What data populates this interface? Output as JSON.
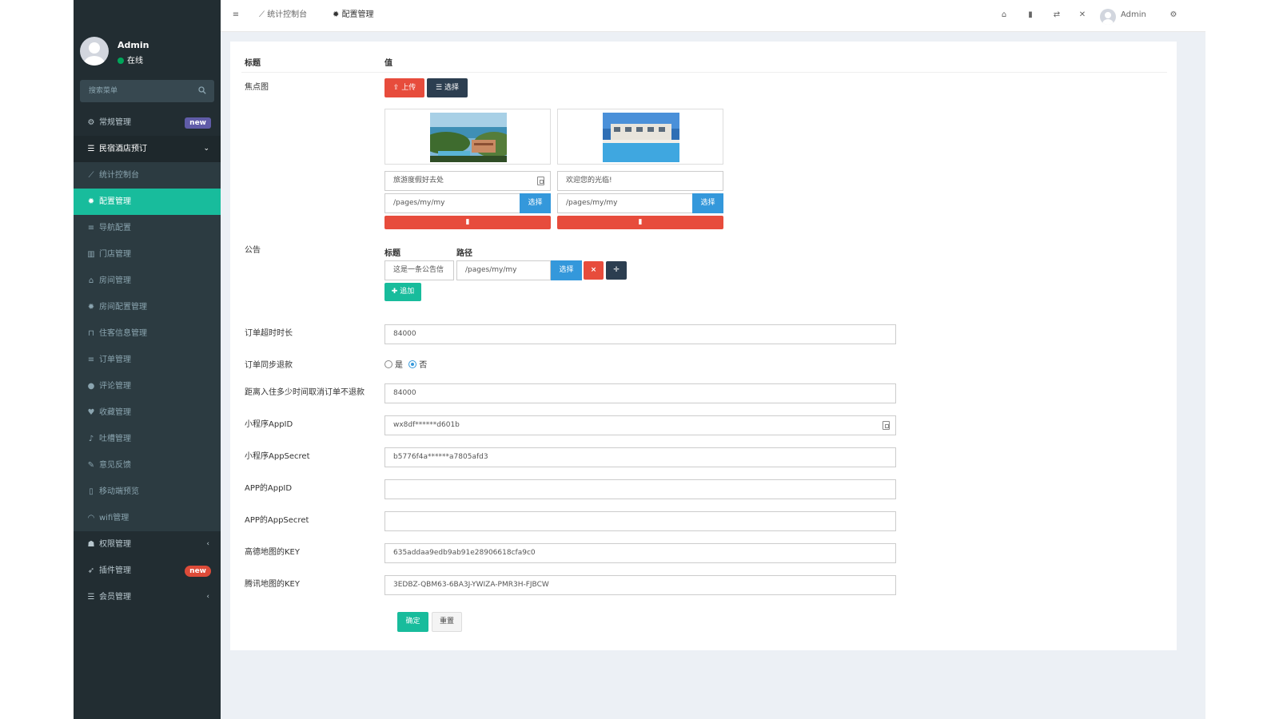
{
  "sidebar": {
    "user_name": "Admin",
    "user_status": "在线",
    "search_placeholder": "搜索菜单",
    "items": [
      {
        "label": "常规管理",
        "icon": "cogs-icon",
        "badge": "new"
      },
      {
        "label": "民宿酒店预订",
        "icon": "list-icon"
      },
      {
        "label": "统计控制台",
        "icon": "line-chart-icon"
      },
      {
        "label": "配置管理",
        "icon": "gear-icon"
      },
      {
        "label": "导航配置",
        "icon": "bars-icon"
      },
      {
        "label": "门店管理",
        "icon": "bank-icon"
      },
      {
        "label": "房间管理",
        "icon": "home-icon"
      },
      {
        "label": "房间配置管理",
        "icon": "gear-icon"
      },
      {
        "label": "住客信息管理",
        "icon": "lock-icon"
      },
      {
        "label": "订单管理",
        "icon": "bars-icon"
      },
      {
        "label": "评论管理",
        "icon": "comments-icon"
      },
      {
        "label": "收藏管理",
        "icon": "heart-icon"
      },
      {
        "label": "吐槽管理",
        "icon": "microphone-icon"
      },
      {
        "label": "意见反馈",
        "icon": "pencil-icon"
      },
      {
        "label": "移动端预览",
        "icon": "mobile-icon"
      },
      {
        "label": "wifi管理",
        "icon": "wifi-icon"
      },
      {
        "label": "权限管理",
        "icon": "users-icon"
      },
      {
        "label": "插件管理",
        "icon": "rocket-icon",
        "badge": "new"
      },
      {
        "label": "会员管理",
        "icon": "list-icon"
      }
    ]
  },
  "header": {
    "tabs": [
      {
        "label": "统计控制台",
        "icon": "line-chart-icon"
      },
      {
        "label": "配置管理",
        "icon": "gear-icon"
      }
    ],
    "user_name": "Admin"
  },
  "table": {
    "col_title": "标题",
    "col_value": "值"
  },
  "focus": {
    "label": "焦点图",
    "upload_label": "上传",
    "choose_label": "选择",
    "slides": [
      {
        "title": "旅游度假好去处",
        "path": "/pages/my/my",
        "choose_label": "选择"
      },
      {
        "title": "欢迎您的光临!",
        "path": "/pages/my/my",
        "choose_label": "选择"
      }
    ]
  },
  "notice": {
    "label": "公告",
    "col_title": "标题",
    "col_path": "路径",
    "row_title": "这是一条公告信",
    "row_path": "/pages/my/my",
    "choose_label": "选择",
    "add_label": "追加"
  },
  "fields": {
    "order_timeout_label": "订单超时时长",
    "order_timeout_value": "84000",
    "refund_sync_label": "订单同步退款",
    "refund_yes": "是",
    "refund_no": "否",
    "refund_selected": "否",
    "cancel_label": "距离入住多少时间取消订单不退款",
    "cancel_value": "84000",
    "mp_appid_label": "小程序AppID",
    "mp_appid_value": "wx8df******d601b",
    "mp_secret_label": "小程序AppSecret",
    "mp_secret_value": "b5776f4a******a7805afd3",
    "app_appid_label": "APP的AppID",
    "app_appid_value": "",
    "app_secret_label": "APP的AppSecret",
    "app_secret_value": "",
    "amap_key_label": "高德地图的KEY",
    "amap_key_value": "635addaa9edb9ab91e28906618cfa9c0",
    "qqmap_key_label": "腾讯地图的KEY",
    "qqmap_key_value": "3EDBZ-QBM63-6BA3J-YWIZA-PMR3H-FJBCW"
  },
  "actions": {
    "submit_label": "确定",
    "reset_label": "重置"
  },
  "colors": {
    "sidebar_bg": "#222d32",
    "active": "#18bc9c",
    "danger": "#e74c3c",
    "info": "#3498db",
    "dark": "#2c3e50"
  }
}
